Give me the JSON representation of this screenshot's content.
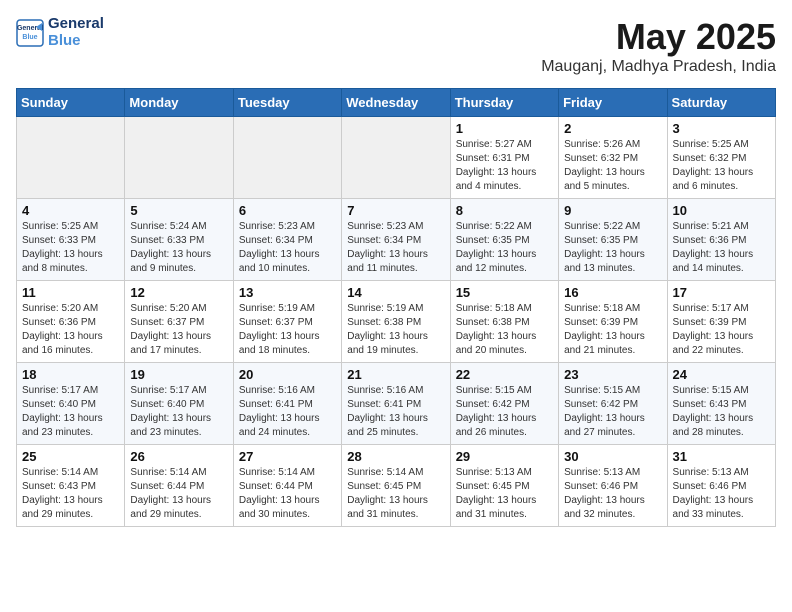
{
  "logo": {
    "line1": "General",
    "line2": "Blue"
  },
  "title": "May 2025",
  "location": "Mauganj, Madhya Pradesh, India",
  "weekdays": [
    "Sunday",
    "Monday",
    "Tuesday",
    "Wednesday",
    "Thursday",
    "Friday",
    "Saturday"
  ],
  "weeks": [
    [
      {
        "day": "",
        "info": ""
      },
      {
        "day": "",
        "info": ""
      },
      {
        "day": "",
        "info": ""
      },
      {
        "day": "",
        "info": ""
      },
      {
        "day": "1",
        "info": "Sunrise: 5:27 AM\nSunset: 6:31 PM\nDaylight: 13 hours and 4 minutes."
      },
      {
        "day": "2",
        "info": "Sunrise: 5:26 AM\nSunset: 6:32 PM\nDaylight: 13 hours and 5 minutes."
      },
      {
        "day": "3",
        "info": "Sunrise: 5:25 AM\nSunset: 6:32 PM\nDaylight: 13 hours and 6 minutes."
      }
    ],
    [
      {
        "day": "4",
        "info": "Sunrise: 5:25 AM\nSunset: 6:33 PM\nDaylight: 13 hours and 8 minutes."
      },
      {
        "day": "5",
        "info": "Sunrise: 5:24 AM\nSunset: 6:33 PM\nDaylight: 13 hours and 9 minutes."
      },
      {
        "day": "6",
        "info": "Sunrise: 5:23 AM\nSunset: 6:34 PM\nDaylight: 13 hours and 10 minutes."
      },
      {
        "day": "7",
        "info": "Sunrise: 5:23 AM\nSunset: 6:34 PM\nDaylight: 13 hours and 11 minutes."
      },
      {
        "day": "8",
        "info": "Sunrise: 5:22 AM\nSunset: 6:35 PM\nDaylight: 13 hours and 12 minutes."
      },
      {
        "day": "9",
        "info": "Sunrise: 5:22 AM\nSunset: 6:35 PM\nDaylight: 13 hours and 13 minutes."
      },
      {
        "day": "10",
        "info": "Sunrise: 5:21 AM\nSunset: 6:36 PM\nDaylight: 13 hours and 14 minutes."
      }
    ],
    [
      {
        "day": "11",
        "info": "Sunrise: 5:20 AM\nSunset: 6:36 PM\nDaylight: 13 hours and 16 minutes."
      },
      {
        "day": "12",
        "info": "Sunrise: 5:20 AM\nSunset: 6:37 PM\nDaylight: 13 hours and 17 minutes."
      },
      {
        "day": "13",
        "info": "Sunrise: 5:19 AM\nSunset: 6:37 PM\nDaylight: 13 hours and 18 minutes."
      },
      {
        "day": "14",
        "info": "Sunrise: 5:19 AM\nSunset: 6:38 PM\nDaylight: 13 hours and 19 minutes."
      },
      {
        "day": "15",
        "info": "Sunrise: 5:18 AM\nSunset: 6:38 PM\nDaylight: 13 hours and 20 minutes."
      },
      {
        "day": "16",
        "info": "Sunrise: 5:18 AM\nSunset: 6:39 PM\nDaylight: 13 hours and 21 minutes."
      },
      {
        "day": "17",
        "info": "Sunrise: 5:17 AM\nSunset: 6:39 PM\nDaylight: 13 hours and 22 minutes."
      }
    ],
    [
      {
        "day": "18",
        "info": "Sunrise: 5:17 AM\nSunset: 6:40 PM\nDaylight: 13 hours and 23 minutes."
      },
      {
        "day": "19",
        "info": "Sunrise: 5:17 AM\nSunset: 6:40 PM\nDaylight: 13 hours and 23 minutes."
      },
      {
        "day": "20",
        "info": "Sunrise: 5:16 AM\nSunset: 6:41 PM\nDaylight: 13 hours and 24 minutes."
      },
      {
        "day": "21",
        "info": "Sunrise: 5:16 AM\nSunset: 6:41 PM\nDaylight: 13 hours and 25 minutes."
      },
      {
        "day": "22",
        "info": "Sunrise: 5:15 AM\nSunset: 6:42 PM\nDaylight: 13 hours and 26 minutes."
      },
      {
        "day": "23",
        "info": "Sunrise: 5:15 AM\nSunset: 6:42 PM\nDaylight: 13 hours and 27 minutes."
      },
      {
        "day": "24",
        "info": "Sunrise: 5:15 AM\nSunset: 6:43 PM\nDaylight: 13 hours and 28 minutes."
      }
    ],
    [
      {
        "day": "25",
        "info": "Sunrise: 5:14 AM\nSunset: 6:43 PM\nDaylight: 13 hours and 29 minutes."
      },
      {
        "day": "26",
        "info": "Sunrise: 5:14 AM\nSunset: 6:44 PM\nDaylight: 13 hours and 29 minutes."
      },
      {
        "day": "27",
        "info": "Sunrise: 5:14 AM\nSunset: 6:44 PM\nDaylight: 13 hours and 30 minutes."
      },
      {
        "day": "28",
        "info": "Sunrise: 5:14 AM\nSunset: 6:45 PM\nDaylight: 13 hours and 31 minutes."
      },
      {
        "day": "29",
        "info": "Sunrise: 5:13 AM\nSunset: 6:45 PM\nDaylight: 13 hours and 31 minutes."
      },
      {
        "day": "30",
        "info": "Sunrise: 5:13 AM\nSunset: 6:46 PM\nDaylight: 13 hours and 32 minutes."
      },
      {
        "day": "31",
        "info": "Sunrise: 5:13 AM\nSunset: 6:46 PM\nDaylight: 13 hours and 33 minutes."
      }
    ]
  ]
}
